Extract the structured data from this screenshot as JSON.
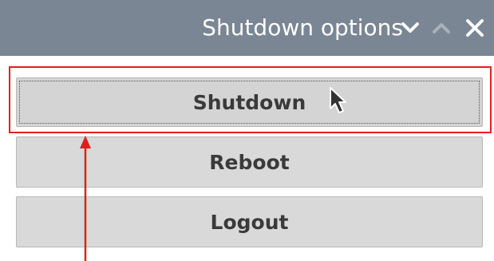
{
  "window": {
    "title": "Shutdown options",
    "controls": {
      "minimize_icon": "chevron-down-icon",
      "maximize_icon": "chevron-up-icon",
      "close_icon": "close-icon"
    }
  },
  "options": {
    "shutdown_label": "Shutdown",
    "reboot_label": "Reboot",
    "logout_label": "Logout"
  },
  "annotation": {
    "highlight_color": "#e02020",
    "target": "Shutdown"
  },
  "colors": {
    "titlebar_bg": "#7a8694",
    "button_bg": "#d9d9d9"
  }
}
